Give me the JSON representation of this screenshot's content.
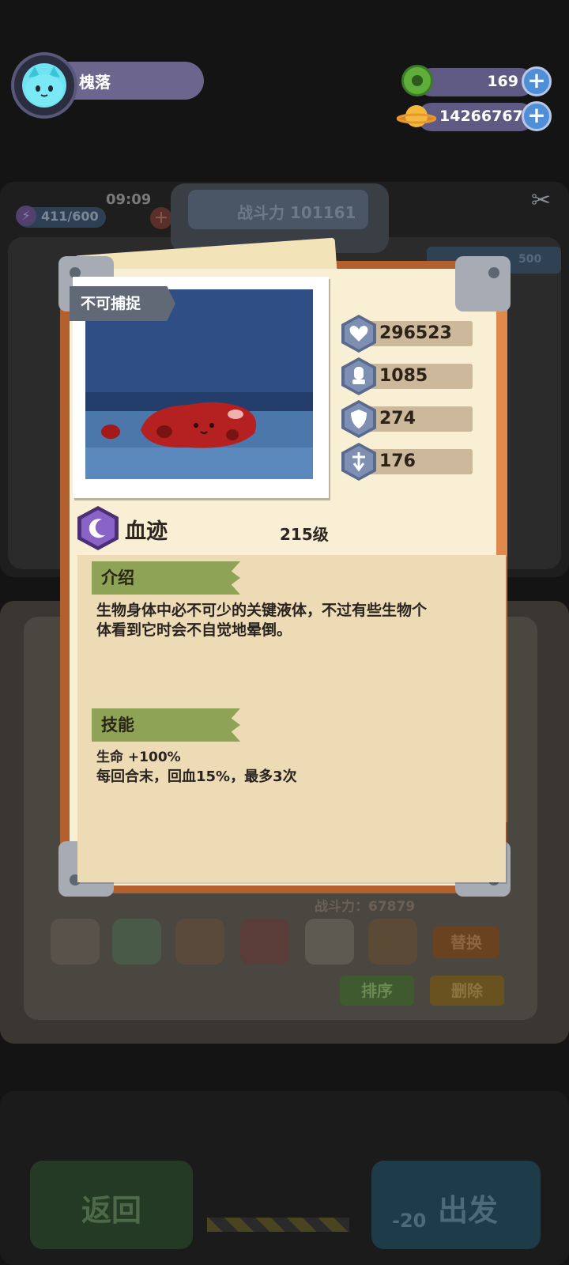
{
  "player": {
    "name": "槐落"
  },
  "currencies": [
    {
      "name": "gems",
      "value": "169"
    },
    {
      "name": "coins",
      "value": "14266767"
    }
  ],
  "background": {
    "time": "09:09",
    "energy": "411/600",
    "combat_power_label": "战斗力 101161",
    "team_power_label": "战斗力：67879",
    "replace_label": "替换",
    "sort_label": "排序",
    "delete_label": "删除",
    "back_label": "返回",
    "depart_label": "出发",
    "depart_cost": "-20",
    "side_value": "500"
  },
  "monster_card": {
    "tag": "不可捕捉",
    "name": "血迹",
    "level": "215级",
    "stats": [
      {
        "icon": "heart-icon",
        "value": "296523"
      },
      {
        "icon": "fist-icon",
        "value": "1085"
      },
      {
        "icon": "shield-icon",
        "value": "274"
      },
      {
        "icon": "speed-icon",
        "value": "176"
      }
    ],
    "intro_title": "介绍",
    "intro_text_line1": "生物身体中必不可少的关键液体，不过有些生物个",
    "intro_text_line2": "体看到它时会不自觉地晕倒。",
    "skill_title": "技能",
    "skill_line1": "生命 +100%",
    "skill_line2": "每回合末，回血15%，最多3次"
  }
}
